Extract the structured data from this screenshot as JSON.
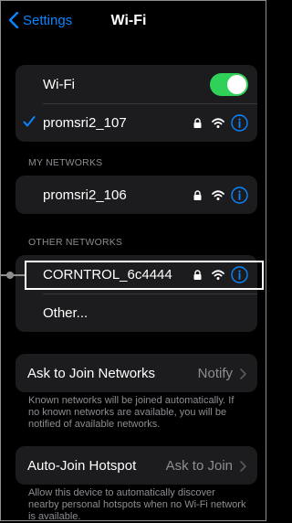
{
  "nav": {
    "back_label": "Settings",
    "title": "Wi-Fi"
  },
  "wifi_group": {
    "wifi_label": "Wi-Fi",
    "wifi_on": true,
    "connected_network": "promsri2_107"
  },
  "my_networks": {
    "header": "MY NETWORKS",
    "networks": [
      "promsri2_106"
    ]
  },
  "other_networks": {
    "header": "OTHER NETWORKS",
    "networks": [
      "CORNTROL_6c4444"
    ],
    "other_label": "Other..."
  },
  "ask_to_join": {
    "label": "Ask to Join Networks",
    "value": "Notify",
    "footer": "Known networks will be joined automatically. If no known networks are available, you will be notified of available networks."
  },
  "auto_join": {
    "label": "Auto-Join Hotspot",
    "value": "Ask to Join",
    "footer": "Allow this device to automatically discover nearby personal hotspots when no Wi-Fi network is available."
  },
  "colors": {
    "accent": "#0a84ff",
    "toggle_on": "#30d158"
  }
}
